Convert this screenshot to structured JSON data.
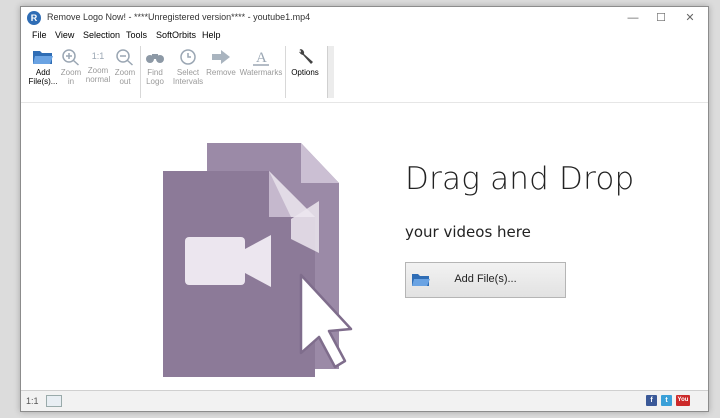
{
  "window": {
    "title": "Remove Logo Now! - ****Unregistered version**** - youtube1.mp4",
    "minimize": "—",
    "maximize": "☐",
    "close": "✕"
  },
  "menu": [
    "File",
    "View",
    "Selection",
    "Tools",
    "SoftOrbits",
    "Help"
  ],
  "toolbar": {
    "add_files": "Add\nFile(s)...",
    "zoom_in": "Zoom\nin",
    "zoom_normal_glyph": "1:1",
    "zoom_normal": "Zoom\nnormal",
    "zoom_out": "Zoom\nout",
    "find_logo": "Find\nLogo",
    "select_intervals": "Select\nIntervals",
    "remove": "Remove",
    "watermarks": "Watermarks",
    "options": "Options"
  },
  "main": {
    "title": "Drag and Drop",
    "subtitle": "your videos here",
    "add_button": "Add File(s)..."
  },
  "status": {
    "zoom": "1:1",
    "social": [
      "f",
      "t",
      "You"
    ]
  },
  "colors": {
    "illustration_purple": "#8c7a98",
    "illustration_light": "#a797b0",
    "icon_blue": "#3d7cc9"
  }
}
